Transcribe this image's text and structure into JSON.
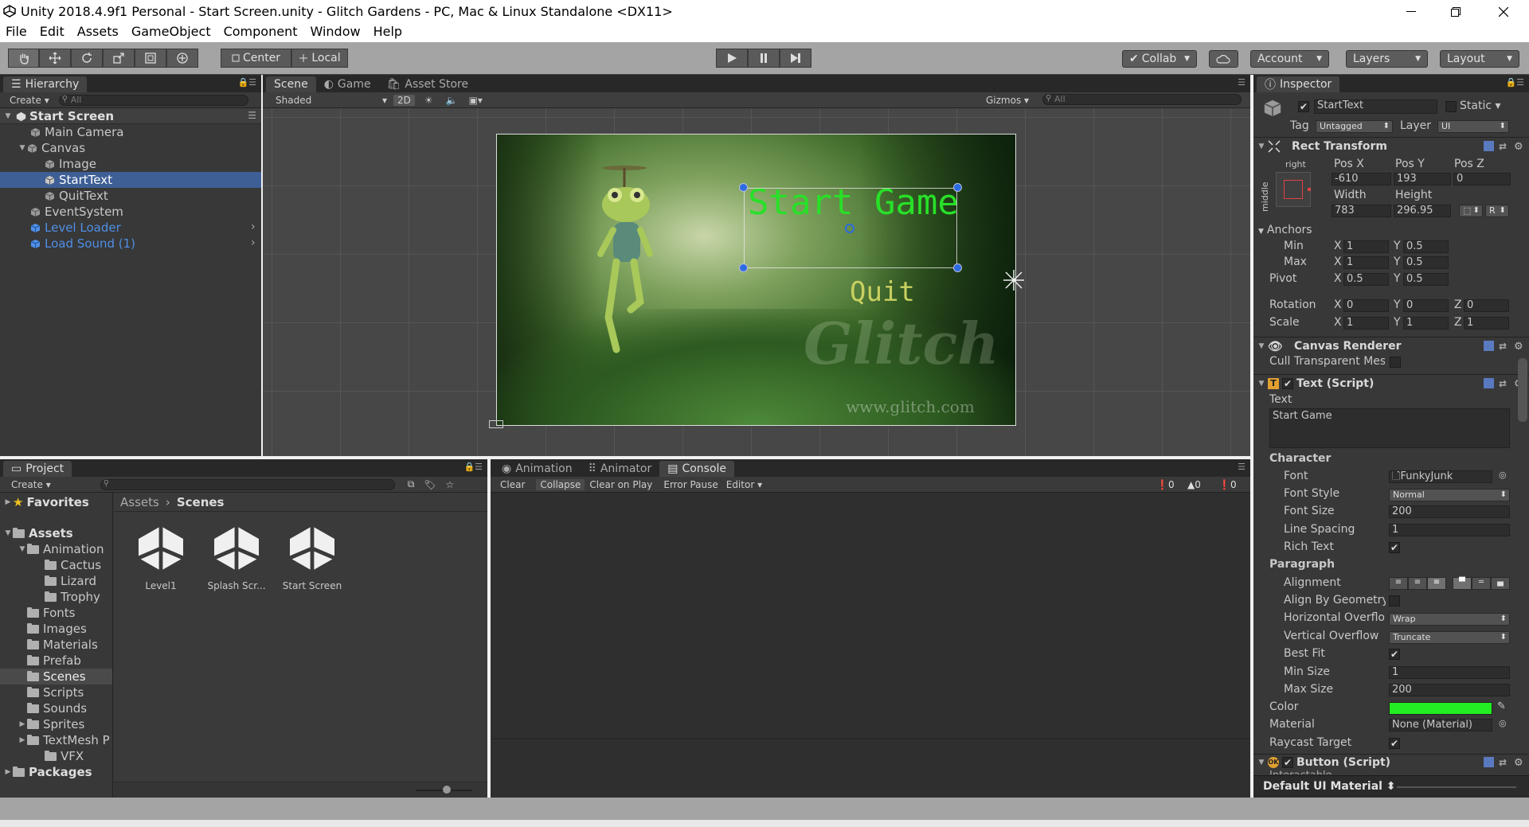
{
  "window": {
    "title": "Unity 2018.4.9f1 Personal - Start Screen.unity - Glitch Gardens - PC, Mac & Linux Standalone <DX11>"
  },
  "menu": [
    "File",
    "Edit",
    "Assets",
    "GameObject",
    "Component",
    "Window",
    "Help"
  ],
  "toolbar": {
    "center": "Center",
    "local": "Local",
    "collab": "Collab",
    "account": "Account",
    "layers": "Layers",
    "layout": "Layout"
  },
  "hierarchy": {
    "tab": "Hierarchy",
    "create": "Create",
    "search": "All",
    "scene": "Start Screen",
    "items": [
      {
        "label": "Main Camera"
      },
      {
        "label": "Canvas"
      },
      {
        "label": "Image"
      },
      {
        "label": "StartText"
      },
      {
        "label": "QuitText"
      },
      {
        "label": "EventSystem"
      },
      {
        "label": "Level Loader"
      },
      {
        "label": "Load Sound (1)"
      }
    ]
  },
  "scene": {
    "tabs": [
      "Scene",
      "Game",
      "Asset Store"
    ],
    "shading": "Shaded",
    "mode2d": "2D",
    "gizmos": "Gizmos",
    "search": "All",
    "start_text": "Start Game",
    "quit_text": "Quit",
    "watermark": "Glitch",
    "watermark_url": "www.glitch.com"
  },
  "project": {
    "tab": "Project",
    "create": "Create",
    "favorites": "Favorites",
    "assets": "Assets",
    "packages": "Packages",
    "breadcrumb": [
      "Assets",
      "Scenes"
    ],
    "folders": [
      "Animation",
      "Cactus",
      "Lizard",
      "Trophy",
      "Fonts",
      "Images",
      "Materials",
      "Prefab",
      "Scenes",
      "Scripts",
      "Sounds",
      "Sprites",
      "TextMesh P",
      "VFX"
    ],
    "files": [
      "Level1",
      "Splash Scr...",
      "Start Screen"
    ]
  },
  "console": {
    "tabs": [
      "Animation",
      "Animator",
      "Console"
    ],
    "buttons": [
      "Clear",
      "Collapse",
      "Clear on Play",
      "Error Pause",
      "Editor"
    ],
    "counts": [
      "0",
      "0",
      "0"
    ]
  },
  "inspector": {
    "tab": "Inspector",
    "name": "StartText",
    "static": "Static",
    "tag_label": "Tag",
    "tag": "Untagged",
    "layer_label": "Layer",
    "layer": "UI",
    "rect_transform": "Rect Transform",
    "anchor_h": "right",
    "anchor_v": "middle",
    "pos_x_label": "Pos X",
    "pos_y_label": "Pos Y",
    "pos_z_label": "Pos Z",
    "pos_x": "-610",
    "pos_y": "193",
    "pos_z": "0",
    "width_label": "Width",
    "height_label": "Height",
    "width": "783",
    "height": "296.95",
    "r": "R",
    "anchors": "Anchors",
    "min": "Min",
    "max": "Max",
    "pivot": "Pivot",
    "rotation": "Rotation",
    "scale": "Scale",
    "x": "X",
    "y": "Y",
    "z": "Z",
    "min_x": "1",
    "min_y": "0.5",
    "max_x": "1",
    "max_y": "0.5",
    "pivot_x": "0.5",
    "pivot_y": "0.5",
    "rot_x": "0",
    "rot_y": "0",
    "rot_z": "0",
    "scale_x": "1",
    "scale_y": "1",
    "scale_z": "1",
    "canvas_renderer": "Canvas Renderer",
    "cull": "Cull Transparent Mes",
    "text_script": "Text (Script)",
    "text_label": "Text",
    "text_value": "Start Game",
    "character": "Character",
    "font_label": "Font",
    "font": "FunkyJunk",
    "font_style_label": "Font Style",
    "font_style": "Normal",
    "font_size_label": "Font Size",
    "font_size": "200",
    "line_spacing_label": "Line Spacing",
    "line_spacing": "1",
    "rich_text_label": "Rich Text",
    "paragraph": "Paragraph",
    "alignment_label": "Alignment",
    "align_geom_label": "Align By Geometry",
    "h_overflow_label": "Horizontal Overflo",
    "h_overflow": "Wrap",
    "v_overflow_label": "Vertical Overflow",
    "v_overflow": "Truncate",
    "best_fit_label": "Best Fit",
    "min_size_label": "Min Size",
    "min_size": "1",
    "max_size_label": "Max Size",
    "max_size": "200",
    "color_label": "Color",
    "color": "#22ee22",
    "material_label": "Material",
    "material": "None (Material)",
    "raycast_label": "Raycast Target",
    "button_script": "Button (Script)",
    "interactable": "Interactable",
    "default_material": "Default UI Material"
  }
}
